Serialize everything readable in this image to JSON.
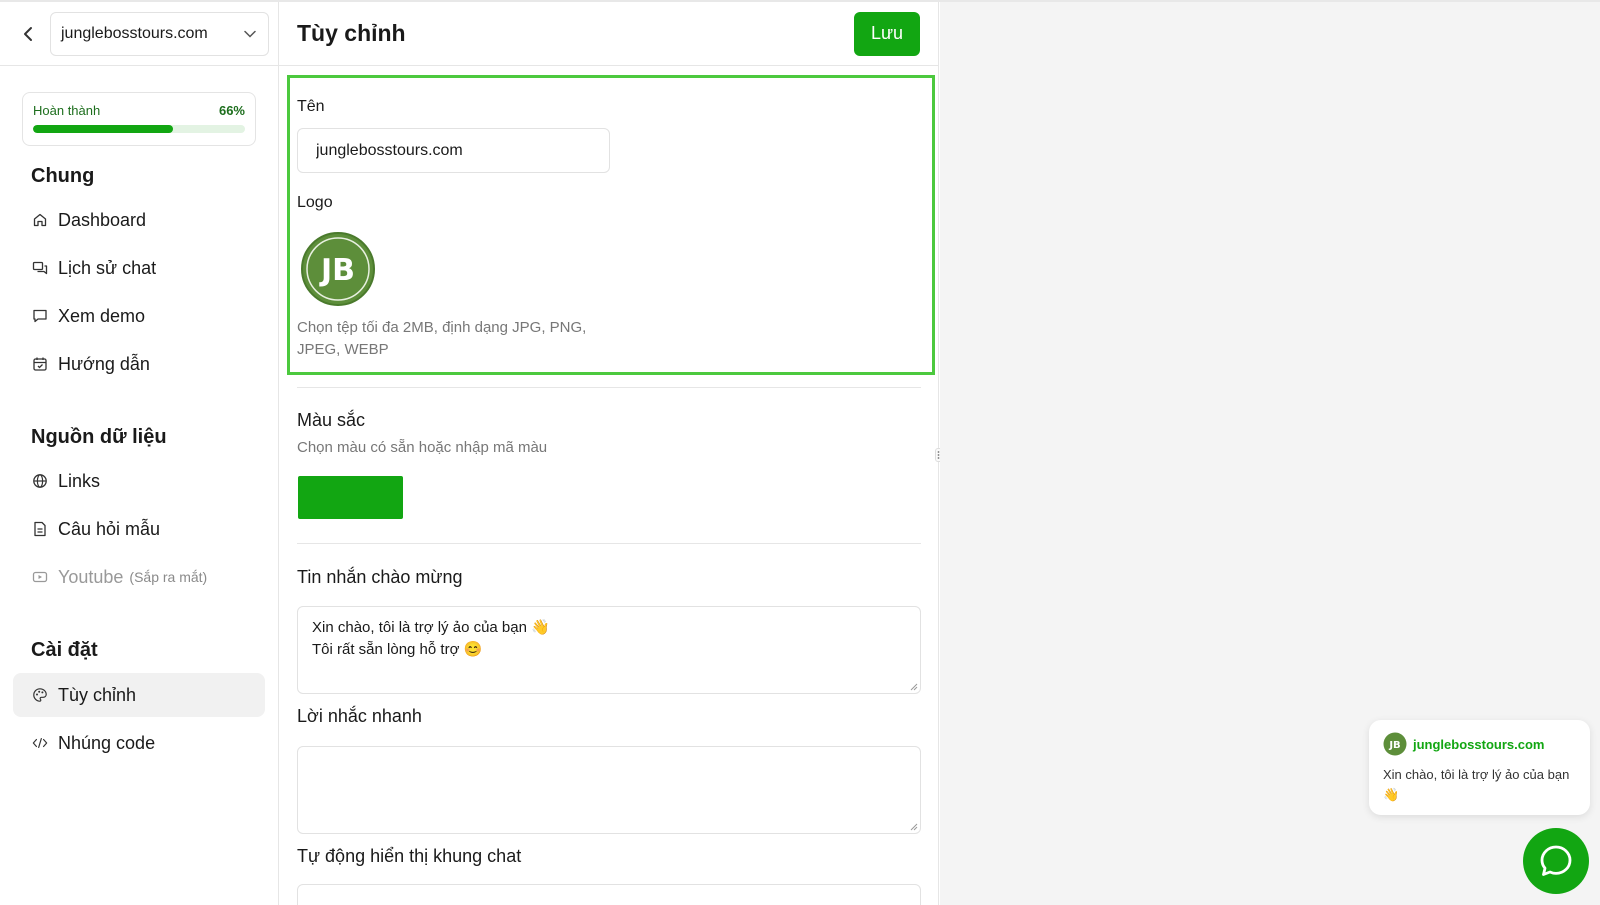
{
  "sidebar": {
    "site": "junglebosstours.com",
    "progress": {
      "label": "Hoàn thành",
      "percent_text": "66%",
      "value": 0.66
    },
    "sections": [
      {
        "title": "Chung",
        "items": [
          {
            "label": "Dashboard",
            "icon": "home-icon"
          },
          {
            "label": "Lịch sử chat",
            "icon": "chat-history-icon"
          },
          {
            "label": "Xem demo",
            "icon": "message-icon"
          },
          {
            "label": "Hướng dẫn",
            "icon": "calendar-icon"
          }
        ]
      },
      {
        "title": "Nguồn dữ liệu",
        "items": [
          {
            "label": "Links",
            "icon": "globe-icon"
          },
          {
            "label": "Câu hỏi mẫu",
            "icon": "document-icon"
          },
          {
            "label": "Youtube",
            "soon": "(Sắp ra mắt)",
            "icon": "youtube-icon"
          }
        ]
      },
      {
        "title": "Cài đặt",
        "items": [
          {
            "label": "Tùy chỉnh",
            "icon": "palette-icon",
            "active": true
          },
          {
            "label": "Nhúng code",
            "icon": "code-icon"
          }
        ]
      }
    ]
  },
  "main": {
    "title": "Tùy chỉnh",
    "save_label": "Lưu",
    "name_label": "Tên",
    "name_value": "junglebosstours.com",
    "logo_label": "Logo",
    "logo_text": "JB",
    "logo_hint": "Chọn tệp tối đa 2MB, định dạng JPG, PNG, JPEG, WEBP",
    "color_title": "Màu sắc",
    "color_hint": "Chọn màu có sẵn hoặc nhập mã màu",
    "color_value": "#12a612",
    "welcome_title": "Tin nhắn chào mừng",
    "welcome_lines": [
      "Xin chào, tôi là trợ lý ảo của bạn 👋",
      "Tôi rất sẵn lòng hỗ trợ 😊"
    ],
    "quick_title": "Lời nhắc nhanh",
    "quick_value": "",
    "auto_title": "Tự động hiển thị khung chat"
  },
  "preview": {
    "bot_name": "junglebosstours.com",
    "message": "Xin chào, tôi là trợ lý ảo của bạn 👋"
  },
  "colors": {
    "accent": "#12a612",
    "highlight": "#4cc93e"
  }
}
